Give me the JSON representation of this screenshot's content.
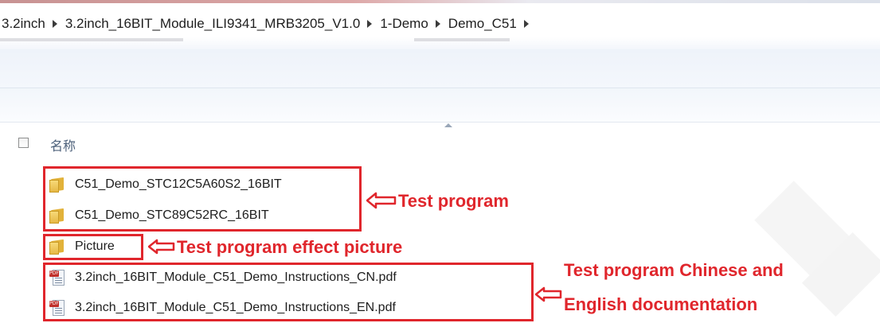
{
  "breadcrumb": {
    "items": [
      "3.2inch",
      "3.2inch_16BIT_Module_ILI9341_MRB3205_V1.0",
      "1-Demo",
      "Demo_C51"
    ]
  },
  "column_header": {
    "name_label": "名称"
  },
  "files": [
    {
      "name": "C51_Demo_STC12C5A60S2_16BIT",
      "icon": "folder-icon"
    },
    {
      "name": "C51_Demo_STC89C52RC_16BIT",
      "icon": "folder-icon"
    },
    {
      "name": "Picture",
      "icon": "folder-icon"
    },
    {
      "name": "3.2inch_16BIT_Module_C51_Demo_Instructions_CN.pdf",
      "icon": "pdf-icon"
    },
    {
      "name": "3.2inch_16BIT_Module_C51_Demo_Instructions_EN.pdf",
      "icon": "pdf-icon"
    }
  ],
  "annotations": {
    "test_program": "Test program",
    "effect_picture": "Test program effect picture",
    "doc_line1": "Test program Chinese and",
    "doc_line2": "English documentation"
  },
  "colors": {
    "annotation": "#e0262c",
    "folder": "#e6b845"
  }
}
